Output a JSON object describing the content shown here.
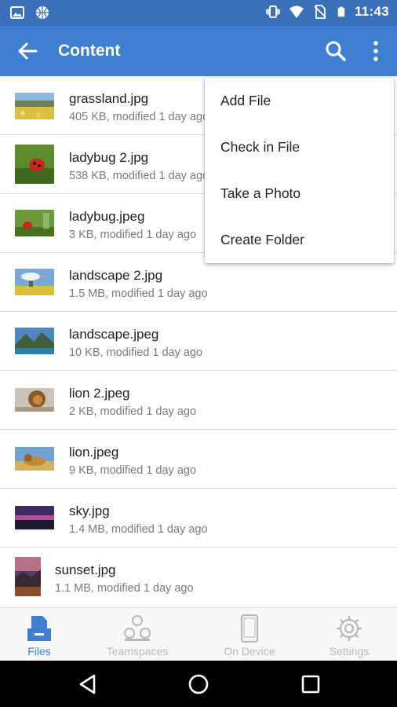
{
  "status_bar": {
    "time": "11:43",
    "left_icons": [
      "image-icon",
      "basketball-icon"
    ],
    "right_icons": [
      "vibrate-icon",
      "wifi-icon",
      "no-sim-icon",
      "battery-icon"
    ]
  },
  "app_bar": {
    "title": "Content",
    "back_icon": "arrow-back-icon",
    "search_icon": "search-icon",
    "more_icon": "more-vert-icon",
    "color": "#3f7fd1"
  },
  "files": [
    {
      "name": "grassland.jpg",
      "meta": "405 KB, modified 1 day ago",
      "thumb": "grassland"
    },
    {
      "name": "ladybug 2.jpg",
      "meta": "538 KB, modified 1 day ago",
      "thumb": "ladybug"
    },
    {
      "name": "ladybug.jpeg",
      "meta": "3 KB, modified 1 day ago",
      "thumb": "ladybug-small"
    },
    {
      "name": "landscape 2.jpg",
      "meta": "1.5 MB, modified 1 day ago",
      "thumb": "landscape"
    },
    {
      "name": "landscape.jpeg",
      "meta": "10 KB, modified 1 day ago",
      "thumb": "mountains"
    },
    {
      "name": "lion 2.jpeg",
      "meta": "2 KB, modified 1 day ago",
      "thumb": "lion"
    },
    {
      "name": "lion.jpeg",
      "meta": "9 KB, modified 1 day ago",
      "thumb": "lion-lying"
    },
    {
      "name": "sky.jpg",
      "meta": "1.4 MB, modified 1 day ago",
      "thumb": "sky"
    },
    {
      "name": "sunset.jpg",
      "meta": "1.1 MB, modified 1 day ago",
      "thumb": "sunset"
    }
  ],
  "menu": {
    "items": [
      {
        "label": "Add File"
      },
      {
        "label": "Check in File"
      },
      {
        "label": "Take a Photo"
      },
      {
        "label": "Create Folder"
      }
    ]
  },
  "bottom_nav": {
    "items": [
      {
        "label": "Files",
        "icon": "files-icon",
        "active": true
      },
      {
        "label": "Teamspaces",
        "icon": "teamspaces-icon",
        "active": false
      },
      {
        "label": "On Device",
        "icon": "phone-icon",
        "active": false
      },
      {
        "label": "Settings",
        "icon": "gear-icon",
        "active": false
      }
    ],
    "active_color": "#3f7fd1",
    "inactive_color": "#b9b9b9"
  },
  "system_nav": {
    "icons": [
      "back-triangle-icon",
      "home-circle-icon",
      "recents-square-icon"
    ]
  }
}
